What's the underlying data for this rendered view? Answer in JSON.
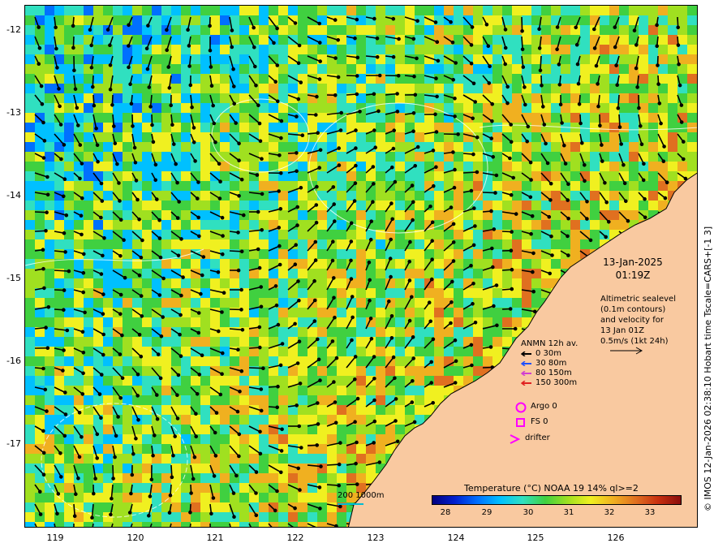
{
  "map": {
    "y_ticks": [
      "-12",
      "-13",
      "-14",
      "-15",
      "-16",
      "-17"
    ],
    "x_ticks": [
      "119",
      "120",
      "121",
      "122",
      "123",
      "124",
      "125",
      "126"
    ],
    "date": "13-Jan-2025",
    "time": "01:19Z",
    "altimetry_lines": [
      "Altimetric sealevel",
      "(0.1m contours)",
      "and velocity for",
      "13 Jan 01Z",
      "0.5m/s (1kt 24h)"
    ],
    "anmn": {
      "title": "ANMN 12h av.",
      "rows": [
        {
          "label": "0 30m",
          "color": "#000000"
        },
        {
          "label": "30 80m",
          "color": "#1e50ff"
        },
        {
          "label": "80 150m",
          "color": "#d040d0"
        },
        {
          "label": "150 300m",
          "color": "#e02020"
        }
      ]
    },
    "argo_label": "Argo 0",
    "fs_label": "FS 0",
    "drifter_label": "drifter",
    "symbol_color": "#ff00ff",
    "temperature_title": "Temperature (°C) NOAA 19 14% ql>=2",
    "colorbar_labels": [
      "28",
      "29",
      "30",
      "31",
      "32",
      "33"
    ],
    "scale_text": "200  1000m",
    "copyright": "© IMOS 12-Jan-2026 02:38:10 Hobart time Tscale=CARS+[-1 3]",
    "land_color": "#f9c9a0",
    "colorbar_colors": [
      "#00007f",
      "#0020d0",
      "#0070ff",
      "#00c0ff",
      "#30e0c0",
      "#40d040",
      "#a0e020",
      "#f0f020",
      "#f0b020",
      "#e07020",
      "#c83010",
      "#8a0e0e"
    ]
  }
}
